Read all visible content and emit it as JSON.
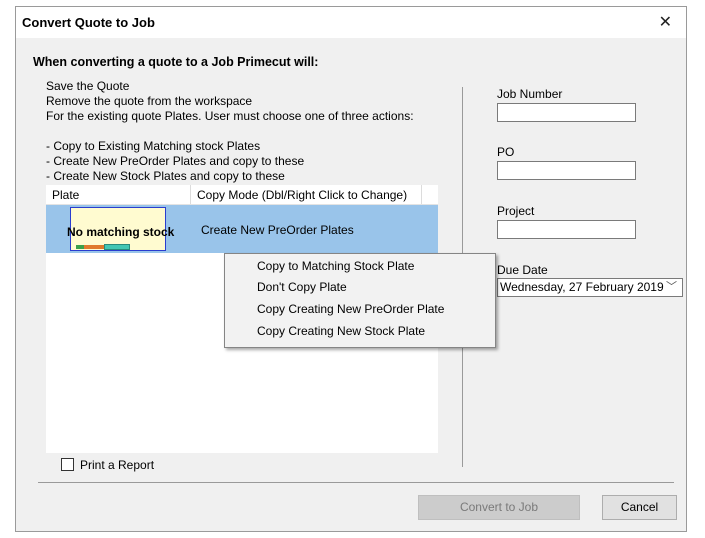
{
  "dialog": {
    "title": "Convert Quote to Job",
    "close_glyph": "✕"
  },
  "heading": "When converting a quote to a Job Primecut will:",
  "info_lines": [
    "Save the Quote",
    "Remove the quote from the workspace",
    "For the existing quote Plates. User must choose one of three actions:",
    "- Copy to Existing Matching stock Plates",
    "- Create New PreOrder Plates and copy to these",
    "- Create New Stock Plates and copy to these"
  ],
  "grid": {
    "columns": [
      "Plate",
      "Copy Mode (Dbl/Right Click to Change)"
    ],
    "rows": [
      {
        "plate": "No matching stock",
        "copy_mode": "Create New PreOrder Plates",
        "selected": true
      }
    ]
  },
  "fields": {
    "job_number_label": "Job Number",
    "job_number_value": "",
    "po_label": "PO",
    "po_value": "",
    "project_label": "Project",
    "project_value": "",
    "due_date_label": "Due Date",
    "due_date_value": "Wednesday, 27 February 2019",
    "due_date_chevron": "﹀"
  },
  "print_report_label": "Print a Report",
  "buttons": {
    "convert": "Convert to Job",
    "cancel": "Cancel"
  },
  "context_menu": {
    "items": [
      "Copy to Matching Stock Plate",
      "Don't Copy Plate",
      "Copy Creating New PreOrder Plate",
      "Copy Creating New Stock Plate"
    ]
  },
  "colors": {
    "selection": "#99c4ea",
    "plate_cell_fill": "#fffbd0",
    "plate_cell_border": "#2a3dcf"
  },
  "icons": {
    "close": "close-icon",
    "chevron": "chevron-down-icon"
  }
}
